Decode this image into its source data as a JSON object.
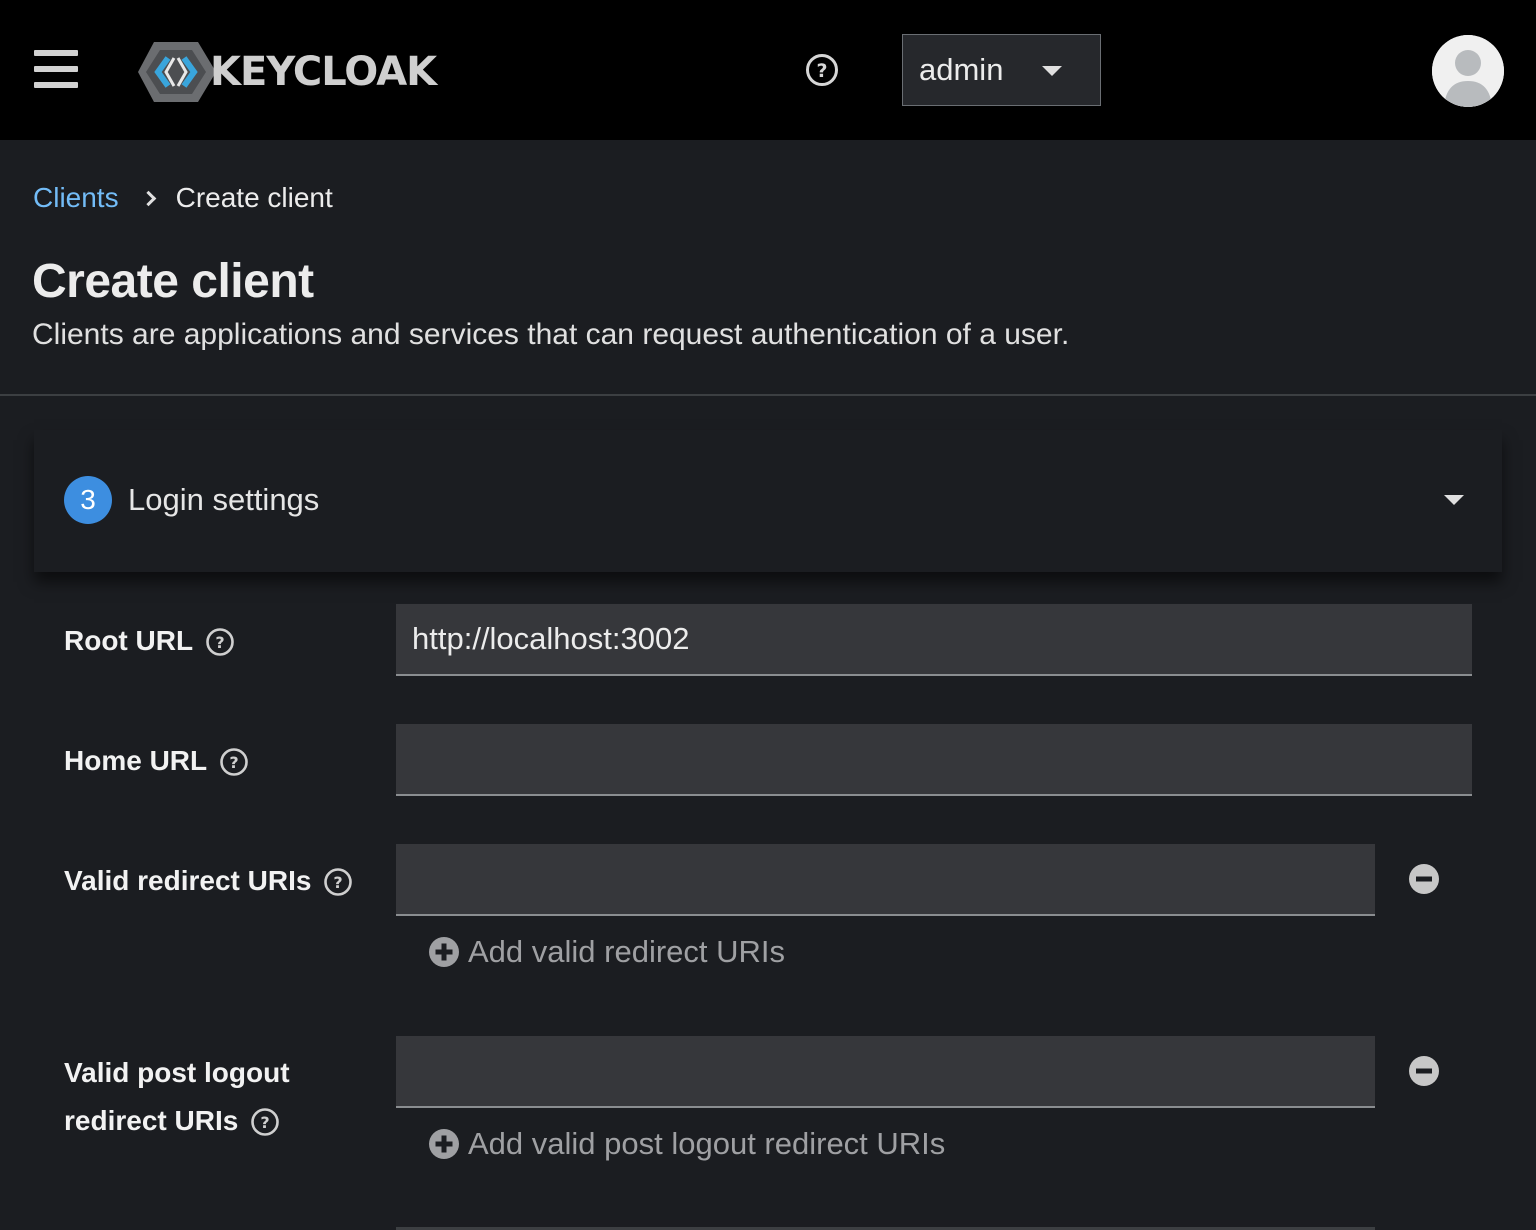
{
  "header": {
    "brand": "KEYCLOAK",
    "user_dropdown_label": "admin"
  },
  "breadcrumb": {
    "parent": "Clients",
    "current": "Create client"
  },
  "page": {
    "title": "Create client",
    "description": "Clients are applications and services that can request authentication of a user."
  },
  "step": {
    "number": "3",
    "title": "Login settings"
  },
  "form": {
    "root_url": {
      "label": "Root URL",
      "value": "http://localhost:3002"
    },
    "home_url": {
      "label": "Home URL",
      "value": ""
    },
    "valid_redirect_uris": {
      "label": "Valid redirect URIs",
      "value": "",
      "add_label": "Add valid redirect URIs"
    },
    "valid_post_logout": {
      "label_line1": "Valid post logout",
      "label_line2": "redirect URIs",
      "value": "",
      "add_label": "Add valid post logout redirect URIs"
    }
  },
  "colors": {
    "masthead_bg": "#000000",
    "page_bg": "#1b1d21",
    "link_blue": "#73bcf7",
    "step_badge": "#3d8ee0",
    "input_bg": "#36373b"
  },
  "icons": {
    "menu": "hamburger-icon",
    "help": "question-circle-icon",
    "dropdown": "caret-down-icon",
    "avatar": "user-avatar-icon",
    "remove": "minus-circle-icon",
    "add": "plus-circle-icon"
  }
}
